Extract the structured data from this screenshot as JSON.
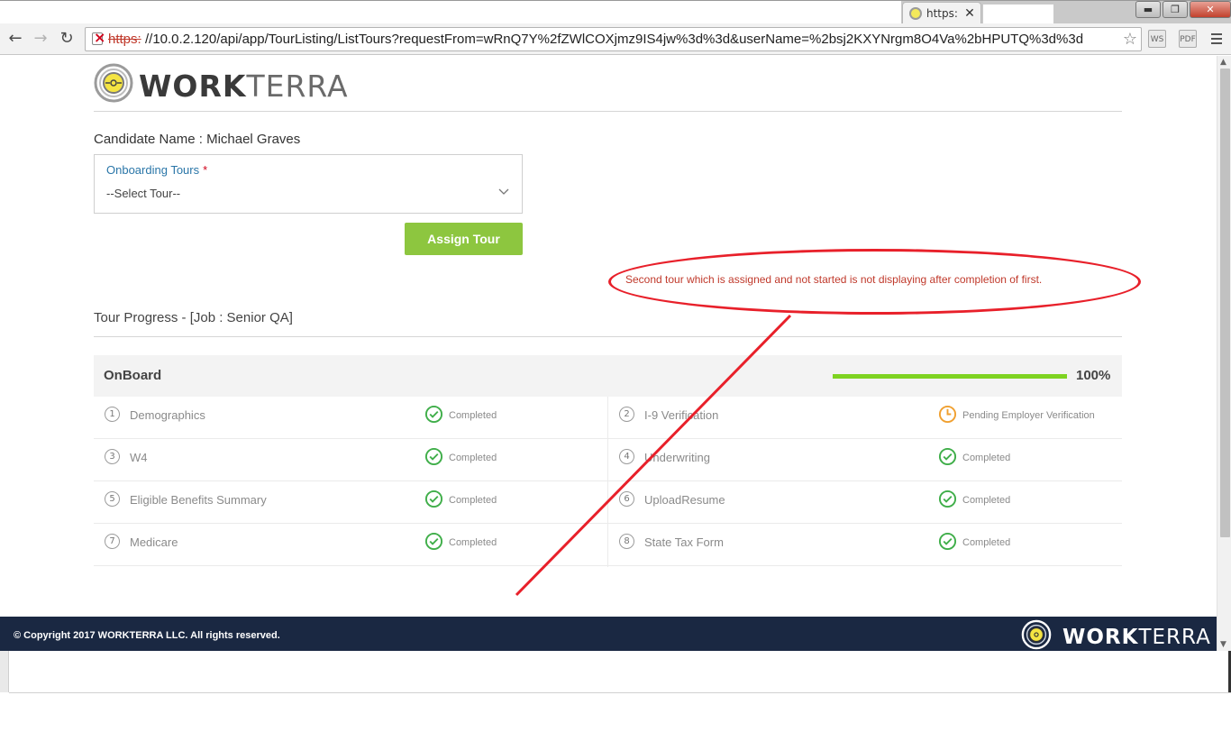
{
  "browser": {
    "tab": {
      "title": "https:/",
      "close_label": "✕"
    },
    "window_buttons": {
      "minimize": "▬",
      "maximize": "❐",
      "close": "✕"
    },
    "nav": {
      "back": "←",
      "forward": "→",
      "reload": "↻"
    },
    "address": {
      "scheme": "https:",
      "url": "//10.0.2.120/api/app/TourListing/ListTours?requestFrom=wRnQ7Y%2fZWlCOXjmz9IS4jw%3d%3d&userName=%2bsj2KXYNrgm8O4Va%2bHPUTQ%3d%3d",
      "security_icon": "insecure-lock-icon",
      "bookmark_star": "☆"
    },
    "extensions": {
      "ws_label": "WS",
      "pdf_label": "PDF"
    }
  },
  "brand": {
    "work": "WORK",
    "terra": "TERRA"
  },
  "candidate": {
    "text": "Candidate Name : Michael Graves"
  },
  "tour_select": {
    "label": "Onboarding Tours",
    "required_mark": "*",
    "selected": "--Select Tour--"
  },
  "assign_button": {
    "label": "Assign Tour"
  },
  "progress": {
    "title": "Tour Progress - [Job : Senior QA]"
  },
  "tour": {
    "name": "OnBoard",
    "percent_label": "100%",
    "percent_value": 1.0,
    "steps": [
      {
        "num": "1",
        "name": "Demographics",
        "status": "Completed",
        "state": "completed"
      },
      {
        "num": "2",
        "name": "I-9 Verification",
        "status": "Pending Employer Verification",
        "state": "pending"
      },
      {
        "num": "3",
        "name": "W4",
        "status": "Completed",
        "state": "completed"
      },
      {
        "num": "4",
        "name": "Underwriting",
        "status": "Completed",
        "state": "completed"
      },
      {
        "num": "5",
        "name": "Eligible Benefits Summary",
        "status": "Completed",
        "state": "completed"
      },
      {
        "num": "6",
        "name": "UploadResume",
        "status": "Completed",
        "state": "completed"
      },
      {
        "num": "7",
        "name": "Medicare",
        "status": "Completed",
        "state": "completed"
      },
      {
        "num": "8",
        "name": "State Tax Form",
        "status": "Completed",
        "state": "completed"
      }
    ]
  },
  "annotation": {
    "text": "Second tour which is assigned and not started is not displaying after completion of first."
  },
  "footer": {
    "copyright": "© Copyright 2017 WORKTERRA LLC. All rights reserved."
  },
  "colors": {
    "accent_green": "#8dc63f",
    "progress_green": "#7ed321",
    "status_completed": "#3fae49",
    "status_pending": "#f0a030",
    "footer_bg": "#1a2842",
    "annotation_red": "#e8202a"
  }
}
